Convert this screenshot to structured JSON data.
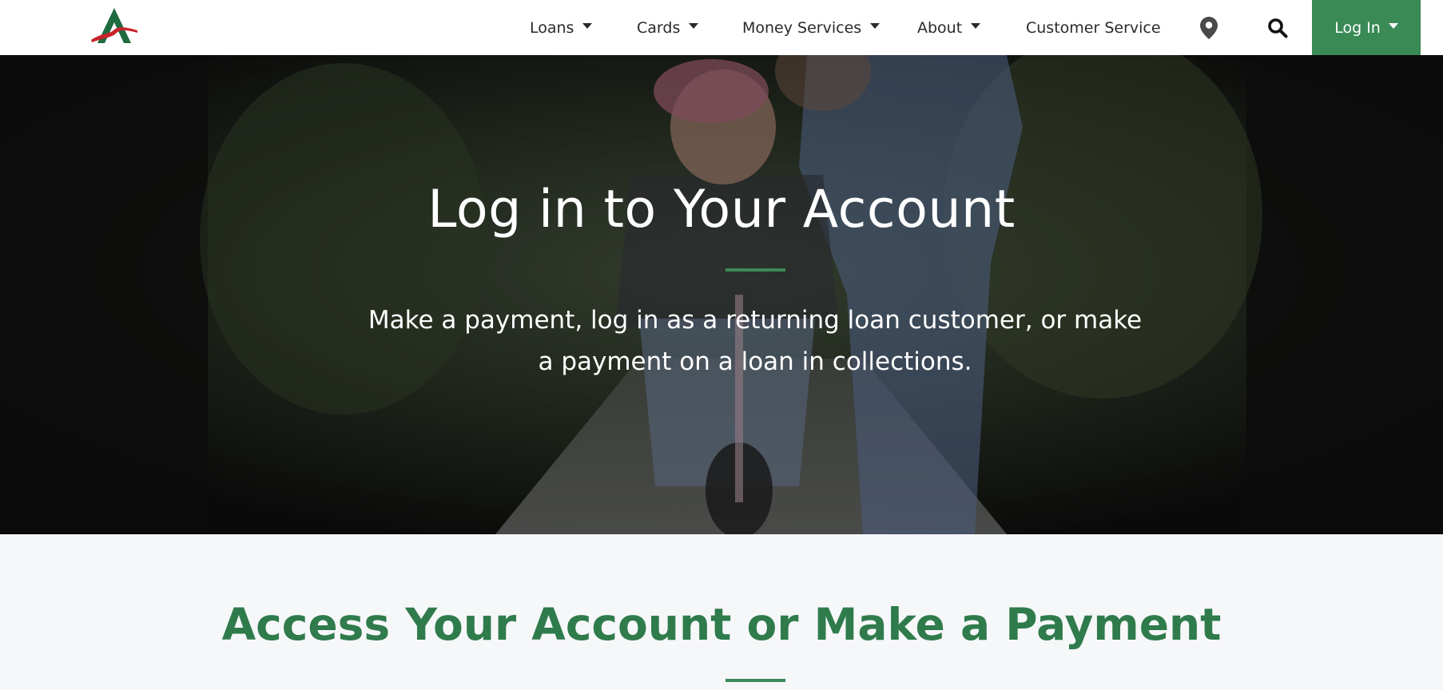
{
  "brand": {
    "accent": "#3a8a56",
    "logo_red": "#c8232c",
    "logo_green": "#1f6b3d"
  },
  "nav": {
    "items": [
      {
        "label": "Loans",
        "dropdown": true
      },
      {
        "label": "Cards",
        "dropdown": true
      },
      {
        "label": "Money Services",
        "dropdown": true
      },
      {
        "label": "About",
        "dropdown": true
      },
      {
        "label": "Customer Service",
        "dropdown": false
      }
    ],
    "location_icon": "map-pin-icon",
    "search_icon": "search-icon",
    "login_label": "Log In"
  },
  "hero": {
    "title": "Log in to Your Account",
    "subtitle": "Make a payment, log in as a returning loan customer, or make a payment on a loan in collections."
  },
  "section": {
    "title": "Access Your Account or Make a Payment"
  }
}
